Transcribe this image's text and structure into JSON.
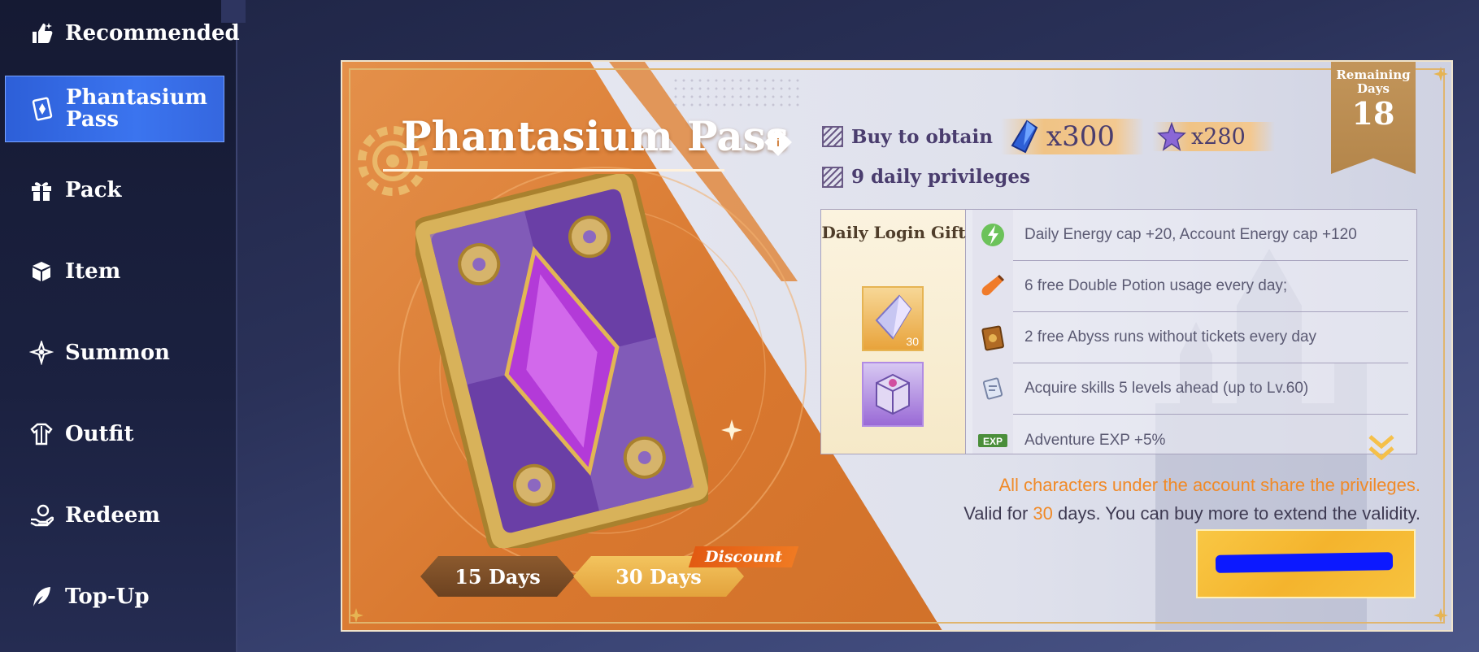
{
  "sidebar": {
    "items": [
      {
        "label": "Recommended",
        "icon": "thumbs-up-icon"
      },
      {
        "label": "Phantasium\nPass",
        "icon": "card-icon",
        "active": true
      },
      {
        "label": "Pack",
        "icon": "gift-icon"
      },
      {
        "label": "Item",
        "icon": "cube-icon"
      },
      {
        "label": "Summon",
        "icon": "summon-icon"
      },
      {
        "label": "Outfit",
        "icon": "outfit-icon"
      },
      {
        "label": "Redeem",
        "icon": "redeem-icon"
      },
      {
        "label": "Top-Up",
        "icon": "feather-icon"
      }
    ]
  },
  "pass": {
    "title": "Phantasium Pass",
    "remaining_label": "Remaining\nDays",
    "remaining_days": "18",
    "buy_label": "Buy to obtain",
    "reward1_amount": "x300",
    "reward2_amount": "x280",
    "privileges_label": "9 daily privileges",
    "login_gift_title": "Daily Login Gift",
    "gift_count": "30",
    "privileges": [
      "Daily Energy cap +20, Account Energy cap +120",
      "6 free Double Potion usage every day;",
      "2 free Abyss runs without tickets every day",
      "Acquire skills 5 levels ahead (up to Lv.60)",
      "Adventure EXP +5%"
    ],
    "share_note": "All characters under the account share the privileges.",
    "valid_prefix": "Valid for ",
    "valid_days": "30",
    "valid_suffix": " days. You can buy more to extend the validity.",
    "day_options": [
      "15 Days",
      "30 Days"
    ],
    "selected_days": "30 Days",
    "discount_label": "Discount"
  },
  "colors": {
    "accent_orange": "#f08a28",
    "sidebar_active": "#3b74ef",
    "buy_button": "#f4b42d",
    "text_purple": "#4a3d6e"
  }
}
